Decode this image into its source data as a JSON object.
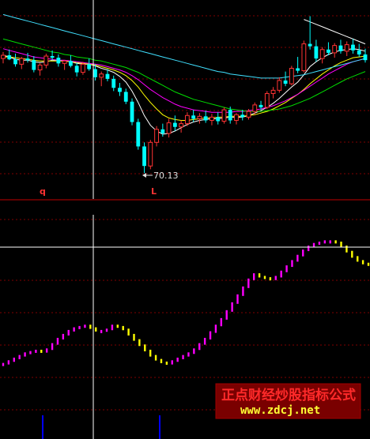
{
  "watermark": {
    "title": "正点财经炒股指标公式",
    "url": "www.zdcj.net"
  },
  "colors": {
    "up_candle": "#ff3333",
    "down_candle": "#00ffff",
    "ma_white": "#ffffff",
    "ma_yellow": "#ffff00",
    "ma_magenta": "#ff00ff",
    "ma_green": "#00dd00",
    "ma_cyan": "#40e0ff",
    "osc_rising": "#ff00ff",
    "osc_falling": "#ffff00",
    "grid": "#800000",
    "crosshair": "#ffffff",
    "signal_bar": "#0000ff",
    "watermark_bg": "#7a0000"
  },
  "chart_data": [
    {
      "type": "candlestick",
      "annotations": {
        "low_label": "70.13",
        "mark_q": "q",
        "mark_l": "L"
      },
      "candles": [
        [
          84.2,
          85.0,
          83.6,
          84.6
        ],
        [
          84.6,
          85.3,
          84.0,
          84.1
        ],
        [
          84.1,
          84.8,
          83.2,
          83.5
        ],
        [
          83.5,
          84.4,
          82.9,
          84.2
        ],
        [
          84.2,
          84.9,
          83.7,
          84.0
        ],
        [
          84.0,
          84.5,
          82.5,
          82.8
        ],
        [
          82.8,
          83.6,
          82.1,
          83.4
        ],
        [
          83.4,
          84.8,
          83.0,
          84.5
        ],
        [
          84.5,
          85.2,
          84.0,
          84.3
        ],
        [
          84.3,
          84.7,
          83.2,
          83.6
        ],
        [
          83.6,
          84.0,
          82.8,
          83.9
        ],
        [
          83.9,
          84.6,
          83.1,
          83.3
        ],
        [
          83.3,
          83.7,
          82.0,
          82.5
        ],
        [
          82.5,
          83.8,
          82.2,
          83.5
        ],
        [
          83.5,
          84.2,
          82.7,
          82.9
        ],
        [
          82.9,
          83.5,
          81.5,
          81.9
        ],
        [
          81.9,
          82.6,
          80.8,
          82.3
        ],
        [
          82.3,
          82.9,
          81.4,
          81.7
        ],
        [
          81.7,
          82.1,
          80.2,
          80.6
        ],
        [
          80.6,
          81.2,
          79.6,
          80.1
        ],
        [
          80.1,
          80.5,
          78.6,
          78.9
        ],
        [
          78.9,
          79.3,
          76.0,
          76.4
        ],
        [
          76.4,
          76.8,
          73.0,
          73.4
        ],
        [
          73.4,
          73.9,
          70.13,
          71.0
        ],
        [
          71.0,
          74.2,
          70.6,
          73.9
        ],
        [
          73.9,
          75.9,
          73.4,
          75.5
        ],
        [
          75.5,
          76.2,
          74.6,
          75.0
        ],
        [
          75.0,
          76.8,
          74.5,
          76.3
        ],
        [
          76.3,
          77.2,
          75.3,
          75.8
        ],
        [
          75.8,
          76.6,
          75.1,
          76.2
        ],
        [
          76.2,
          77.6,
          75.9,
          77.2
        ],
        [
          77.2,
          77.9,
          76.4,
          76.8
        ],
        [
          76.8,
          77.5,
          76.2,
          77.1
        ],
        [
          77.1,
          77.8,
          76.3,
          76.6
        ],
        [
          76.6,
          77.4,
          76.0,
          77.0
        ],
        [
          77.0,
          77.6,
          76.1,
          76.5
        ],
        [
          76.5,
          78.2,
          76.2,
          77.9
        ],
        [
          77.9,
          78.3,
          76.2,
          76.6
        ],
        [
          76.6,
          77.5,
          76.1,
          77.3
        ],
        [
          77.3,
          77.9,
          76.6,
          77.0
        ],
        [
          77.0,
          78.0,
          76.7,
          77.7
        ],
        [
          77.7,
          78.8,
          77.3,
          78.5
        ],
        [
          78.5,
          79.0,
          77.9,
          78.2
        ],
        [
          78.2,
          80.2,
          78.0,
          79.9
        ],
        [
          79.9,
          80.7,
          79.3,
          80.3
        ],
        [
          80.3,
          81.9,
          80.0,
          81.5
        ],
        [
          81.5,
          82.6,
          80.8,
          81.1
        ],
        [
          81.1,
          83.3,
          80.9,
          83.0
        ],
        [
          83.0,
          84.4,
          82.4,
          82.7
        ],
        [
          82.7,
          86.4,
          82.5,
          86.0
        ],
        [
          86.0,
          89.4,
          85.3,
          85.7
        ],
        [
          85.7,
          86.5,
          83.8,
          84.2
        ],
        [
          84.2,
          85.6,
          83.6,
          85.3
        ],
        [
          85.3,
          86.2,
          84.6,
          84.9
        ],
        [
          84.9,
          86.1,
          84.3,
          85.8
        ],
        [
          85.8,
          86.5,
          84.8,
          85.1
        ],
        [
          85.1,
          86.3,
          84.5,
          85.9
        ],
        [
          85.9,
          86.6,
          84.8,
          85.2
        ],
        [
          85.2,
          86.0,
          84.4,
          84.7
        ],
        [
          84.7,
          85.4,
          83.7,
          84.0
        ]
      ],
      "moving_averages": [
        {
          "color": "#ffffff",
          "values": [
            84.6,
            84.4,
            84.1,
            84.0,
            84.0,
            83.8,
            83.7,
            83.8,
            84.0,
            84.0,
            83.9,
            83.8,
            83.6,
            83.5,
            83.5,
            83.3,
            83.0,
            82.8,
            82.5,
            82.0,
            81.3,
            80.2,
            78.8,
            77.2,
            76.0,
            75.3,
            74.9,
            75.0,
            75.3,
            75.7,
            76.1,
            76.4,
            76.6,
            76.7,
            76.8,
            76.8,
            76.9,
            77.0,
            77.0,
            77.0,
            77.2,
            77.5,
            77.8,
            78.2,
            78.7,
            79.3,
            80.0,
            80.7,
            81.3,
            82.2,
            83.2,
            83.8,
            84.3,
            84.7,
            85.0,
            85.2,
            85.3,
            85.4,
            85.3,
            85.1
          ]
        },
        {
          "color": "#ffff00",
          "values": [
            84.4,
            84.4,
            84.3,
            84.2,
            84.1,
            84.0,
            83.9,
            83.9,
            83.9,
            83.9,
            83.9,
            83.8,
            83.7,
            83.6,
            83.5,
            83.4,
            83.2,
            83.0,
            82.8,
            82.5,
            82.1,
            81.5,
            80.7,
            79.7,
            78.8,
            78.0,
            77.3,
            76.9,
            76.7,
            76.6,
            76.6,
            76.7,
            76.8,
            76.9,
            76.9,
            77.0,
            77.0,
            77.1,
            77.1,
            77.1,
            77.2,
            77.3,
            77.5,
            77.7,
            78.0,
            78.4,
            78.8,
            79.3,
            79.8,
            80.4,
            81.1,
            81.7,
            82.3,
            82.8,
            83.3,
            83.7,
            84.0,
            84.3,
            84.4,
            84.5
          ]
        },
        {
          "color": "#ff00ff",
          "values": [
            85.4,
            85.2,
            85.0,
            84.8,
            84.6,
            84.4,
            84.3,
            84.2,
            84.1,
            84.0,
            84.0,
            83.9,
            83.8,
            83.7,
            83.6,
            83.5,
            83.4,
            83.2,
            83.0,
            82.8,
            82.5,
            82.1,
            81.6,
            81.0,
            80.4,
            79.9,
            79.4,
            79.0,
            78.6,
            78.3,
            78.1,
            77.9,
            77.8,
            77.7,
            77.6,
            77.6,
            77.6,
            77.6,
            77.7,
            77.7,
            77.8,
            77.9,
            78.0,
            78.2,
            78.4,
            78.7,
            79.0,
            79.4,
            79.8,
            80.3,
            80.8,
            81.3,
            81.8,
            82.3,
            82.7,
            83.1,
            83.5,
            83.8,
            84.0,
            84.2
          ]
        },
        {
          "color": "#00dd00",
          "values": [
            86.6,
            86.4,
            86.2,
            86.0,
            85.8,
            85.6,
            85.4,
            85.2,
            85.0,
            84.9,
            84.7,
            84.6,
            84.4,
            84.3,
            84.2,
            84.0,
            83.9,
            83.7,
            83.5,
            83.3,
            83.1,
            82.8,
            82.5,
            82.1,
            81.7,
            81.3,
            80.9,
            80.5,
            80.1,
            79.8,
            79.5,
            79.2,
            79.0,
            78.8,
            78.6,
            78.4,
            78.2,
            78.0,
            77.9,
            77.8,
            77.7,
            77.7,
            77.7,
            77.8,
            77.9,
            78.0,
            78.2,
            78.4,
            78.7,
            79.0,
            79.3,
            79.7,
            80.1,
            80.5,
            80.9,
            81.3,
            81.7,
            82.0,
            82.3,
            82.6
          ]
        },
        {
          "color": "#40e0ff",
          "values": [
            89.6,
            89.4,
            89.2,
            89.0,
            88.8,
            88.6,
            88.4,
            88.2,
            88.0,
            87.8,
            87.6,
            87.4,
            87.2,
            87.0,
            86.8,
            86.6,
            86.4,
            86.2,
            86.0,
            85.8,
            85.6,
            85.4,
            85.2,
            85.0,
            84.8,
            84.6,
            84.4,
            84.2,
            84.0,
            83.8,
            83.6,
            83.4,
            83.2,
            83.0,
            82.8,
            82.6,
            82.5,
            82.3,
            82.2,
            82.1,
            82.0,
            81.9,
            81.8,
            81.8,
            81.8,
            81.8,
            81.9,
            82.0,
            82.1,
            82.2,
            82.4,
            82.6,
            82.8,
            83.0,
            83.2,
            83.4,
            83.6,
            83.8,
            84.0,
            84.2
          ]
        },
        {
          "color": "#ffffff",
          "values": [
            null,
            null,
            null,
            null,
            null,
            null,
            null,
            null,
            null,
            null,
            null,
            null,
            null,
            null,
            null,
            null,
            null,
            null,
            null,
            null,
            null,
            null,
            null,
            null,
            null,
            null,
            null,
            null,
            null,
            null,
            null,
            null,
            null,
            null,
            null,
            null,
            null,
            null,
            null,
            null,
            null,
            null,
            null,
            null,
            null,
            null,
            null,
            null,
            null,
            89.0,
            88.7,
            88.4,
            88.1,
            87.8,
            87.5,
            87.2,
            86.9,
            86.6,
            86.3,
            86.0
          ]
        }
      ]
    },
    {
      "type": "oscillator",
      "values": [
        14,
        16,
        18,
        20,
        22,
        23,
        24,
        23,
        25,
        29,
        33,
        36,
        39,
        41,
        42,
        43,
        41,
        39,
        39,
        40,
        43,
        42,
        40,
        36,
        32,
        28,
        24,
        20,
        17,
        15,
        14,
        16,
        18,
        20,
        22,
        25,
        29,
        33,
        38,
        43,
        48,
        54,
        60,
        66,
        72,
        78,
        82,
        80,
        79,
        78,
        80,
        84,
        88,
        92,
        96,
        100,
        103,
        105,
        106,
        107,
        107,
        106,
        103,
        99,
        95,
        92,
        90,
        89
      ]
    }
  ]
}
